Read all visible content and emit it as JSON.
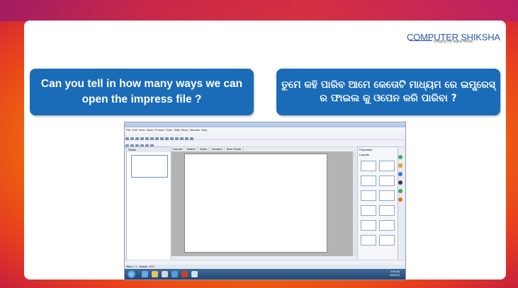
{
  "logo": {
    "text": "COMPUTER SHIKSHA",
    "tagline": "bridging the digital divide"
  },
  "question_english": "Can you tell in how many ways we can open the impress file ?",
  "question_odia": "ତୁମେ କହି ପାରିବ ଆମେ କେତୋଟି ମାଧ୍ୟମ ରେ ଇମ୍ପ୍ରେସ୍ ର ଫାଇଲ କୁ ଓପେନ କରି ପାରିବା ?",
  "app": {
    "menu": [
      "File",
      "Edit",
      "View",
      "Insert",
      "Format",
      "Tools",
      "Slide Show",
      "Window",
      "Help"
    ],
    "slides_pane_title": "Slides",
    "tabs": [
      "Normal",
      "Outline",
      "Notes",
      "Handout",
      "Slide Sorter"
    ],
    "properties_title": "Properties",
    "layouts_title": "Layouts",
    "status_slide": "Slide 1 / 1",
    "status_layout": "Default",
    "status_zoom": "67%",
    "clock_time": "3:59 AM",
    "clock_date": "6/6/2016"
  },
  "colors": {
    "bubble": "#1a6bb8",
    "logo": "#2b5aa8"
  }
}
